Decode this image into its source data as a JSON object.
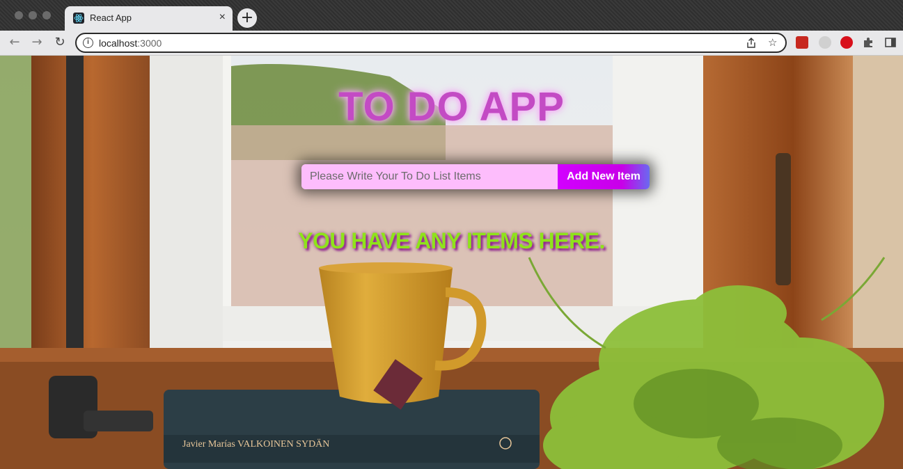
{
  "browser": {
    "tab_title": "React App",
    "tab_close": "×",
    "new_tab": "+",
    "url_host": "localhost",
    "url_port": ":3000",
    "icons": [
      "react-favicon",
      "back-arrow-icon",
      "forward-arrow-icon",
      "reload-icon",
      "info-icon",
      "share-icon",
      "star-icon",
      "extensions-puzzle-icon",
      "sidebar-icon"
    ]
  },
  "app": {
    "title": "TO DO APP",
    "input_placeholder": "Please Write Your To Do List Items",
    "input_value": "",
    "add_button_label": "Add New Item",
    "status_message": "YOU HAVE ANY ITEMS HERE."
  },
  "colors": {
    "title": "#c34bc4",
    "input_bg": "#fdbdfc",
    "button_gradient_start": "#d200ff",
    "button_gradient_end": "#6a6af0",
    "status_text": "#8fe31b",
    "status_shadow": "#8e1e8e"
  }
}
